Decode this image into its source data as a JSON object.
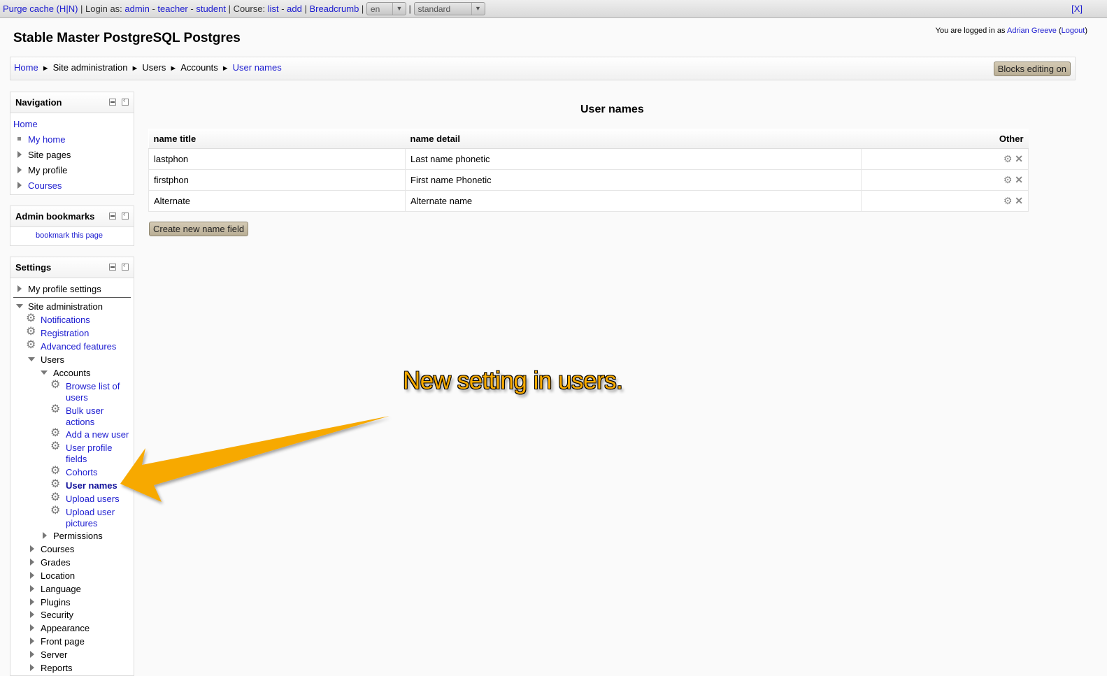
{
  "devbar": {
    "purge": "Purge cache (H|N)",
    "sep1": " | Login as: ",
    "admin": "admin",
    "dash1": " - ",
    "teacher": "teacher",
    "dash2": " - ",
    "student": "student",
    "sep2": " | Course: ",
    "list": "list",
    "dash3": " - ",
    "add": "add",
    "sep3": " | ",
    "breadcrumb": "Breadcrumb",
    "sep4": " | ",
    "lang": "en",
    "sep5": " | ",
    "theme": "standard",
    "close": "[X]"
  },
  "header": {
    "site_title": "Stable Master PostgreSQL Postgres",
    "login_prefix": "You are logged in as ",
    "user": "Adrian Greeve",
    "logout_open": " (",
    "logout": "Logout",
    "logout_close": ")"
  },
  "breadcrumb": {
    "items": [
      "Home",
      "Site administration",
      "Users",
      "Accounts",
      "User names"
    ],
    "sep": "►",
    "editing_button": "Blocks editing on"
  },
  "navigation": {
    "title": "Navigation",
    "home": "Home",
    "items": [
      "My home",
      "Site pages",
      "My profile",
      "Courses"
    ]
  },
  "bookmarks": {
    "title": "Admin bookmarks",
    "link": "bookmark this page"
  },
  "settings": {
    "title": "Settings",
    "my_profile": "My profile settings",
    "site_admin": "Site administration",
    "notifications": "Notifications",
    "registration": "Registration",
    "advanced": "Advanced features",
    "users": "Users",
    "accounts": "Accounts",
    "browse1": "Browse list of",
    "browse2": "users",
    "bulk1": "Bulk user",
    "bulk2": "actions",
    "addnew": "Add a new user",
    "profile1": "User profile",
    "profile2": "fields",
    "cohorts": "Cohorts",
    "usernames": "User names",
    "upload": "Upload users",
    "pictures1": "Upload user",
    "pictures2": "pictures",
    "permissions": "Permissions",
    "sections": [
      "Courses",
      "Grades",
      "Location",
      "Language",
      "Plugins",
      "Security",
      "Appearance",
      "Front page",
      "Server",
      "Reports"
    ]
  },
  "main": {
    "heading": "User names",
    "columns": [
      "name title",
      "name detail",
      "Other"
    ],
    "rows": [
      {
        "title": "lastphon",
        "detail": "Last name phonetic"
      },
      {
        "title": "firstphon",
        "detail": "First name Phonetic"
      },
      {
        "title": "Alternate",
        "detail": "Alternate name"
      }
    ],
    "create_button": "Create new name field"
  },
  "annotation": {
    "text": "New setting in users.",
    "color": "#f7a900"
  }
}
